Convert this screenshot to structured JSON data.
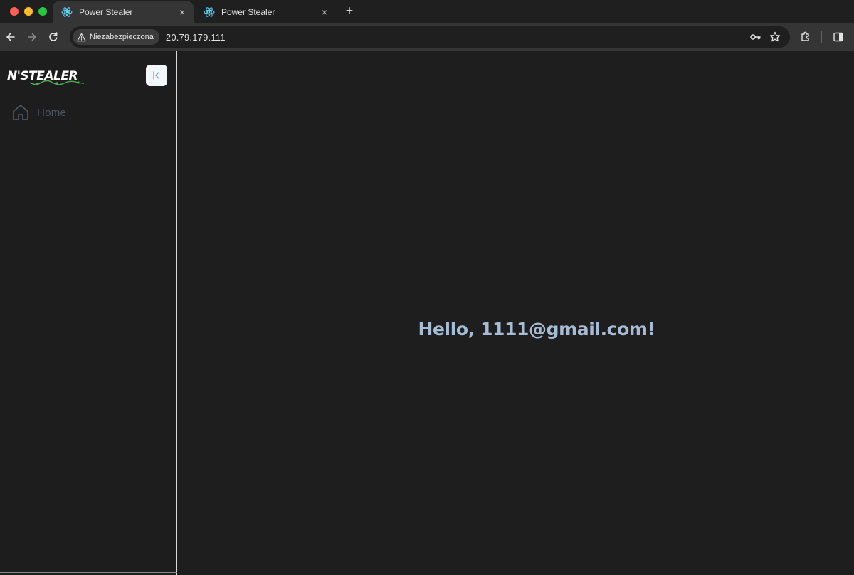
{
  "browser": {
    "tabs": [
      {
        "title": "Power Stealer",
        "active": true
      },
      {
        "title": "Power Stealer",
        "active": false
      }
    ],
    "close_glyph": "×",
    "new_tab_glyph": "+",
    "security_label": "Niezabezpieczona",
    "url": "20.79.179.111",
    "icons": {
      "favicon": "react-atom-icon",
      "back": "arrow-left-icon",
      "forward": "arrow-right-icon",
      "reload": "reload-icon",
      "warning": "warning-triangle-icon",
      "password": "key-icon",
      "bookmark": "star-icon",
      "extensions": "puzzle-icon",
      "side_panel": "side-panel-icon"
    }
  },
  "sidebar": {
    "logo_text": "N'STEALER",
    "collapse_icon": "collapse-left-icon",
    "items": [
      {
        "label": "Home",
        "icon": "home-icon"
      }
    ]
  },
  "main": {
    "greeting": "Hello, 1111@gmail.com!"
  },
  "colors": {
    "page_bg": "#1e1e1e",
    "sidebar_bg": "#1d1d1d",
    "greeting": "#a6bbd4",
    "nav_inactive": "#4a5566",
    "logo_accent": "#4caf50"
  }
}
